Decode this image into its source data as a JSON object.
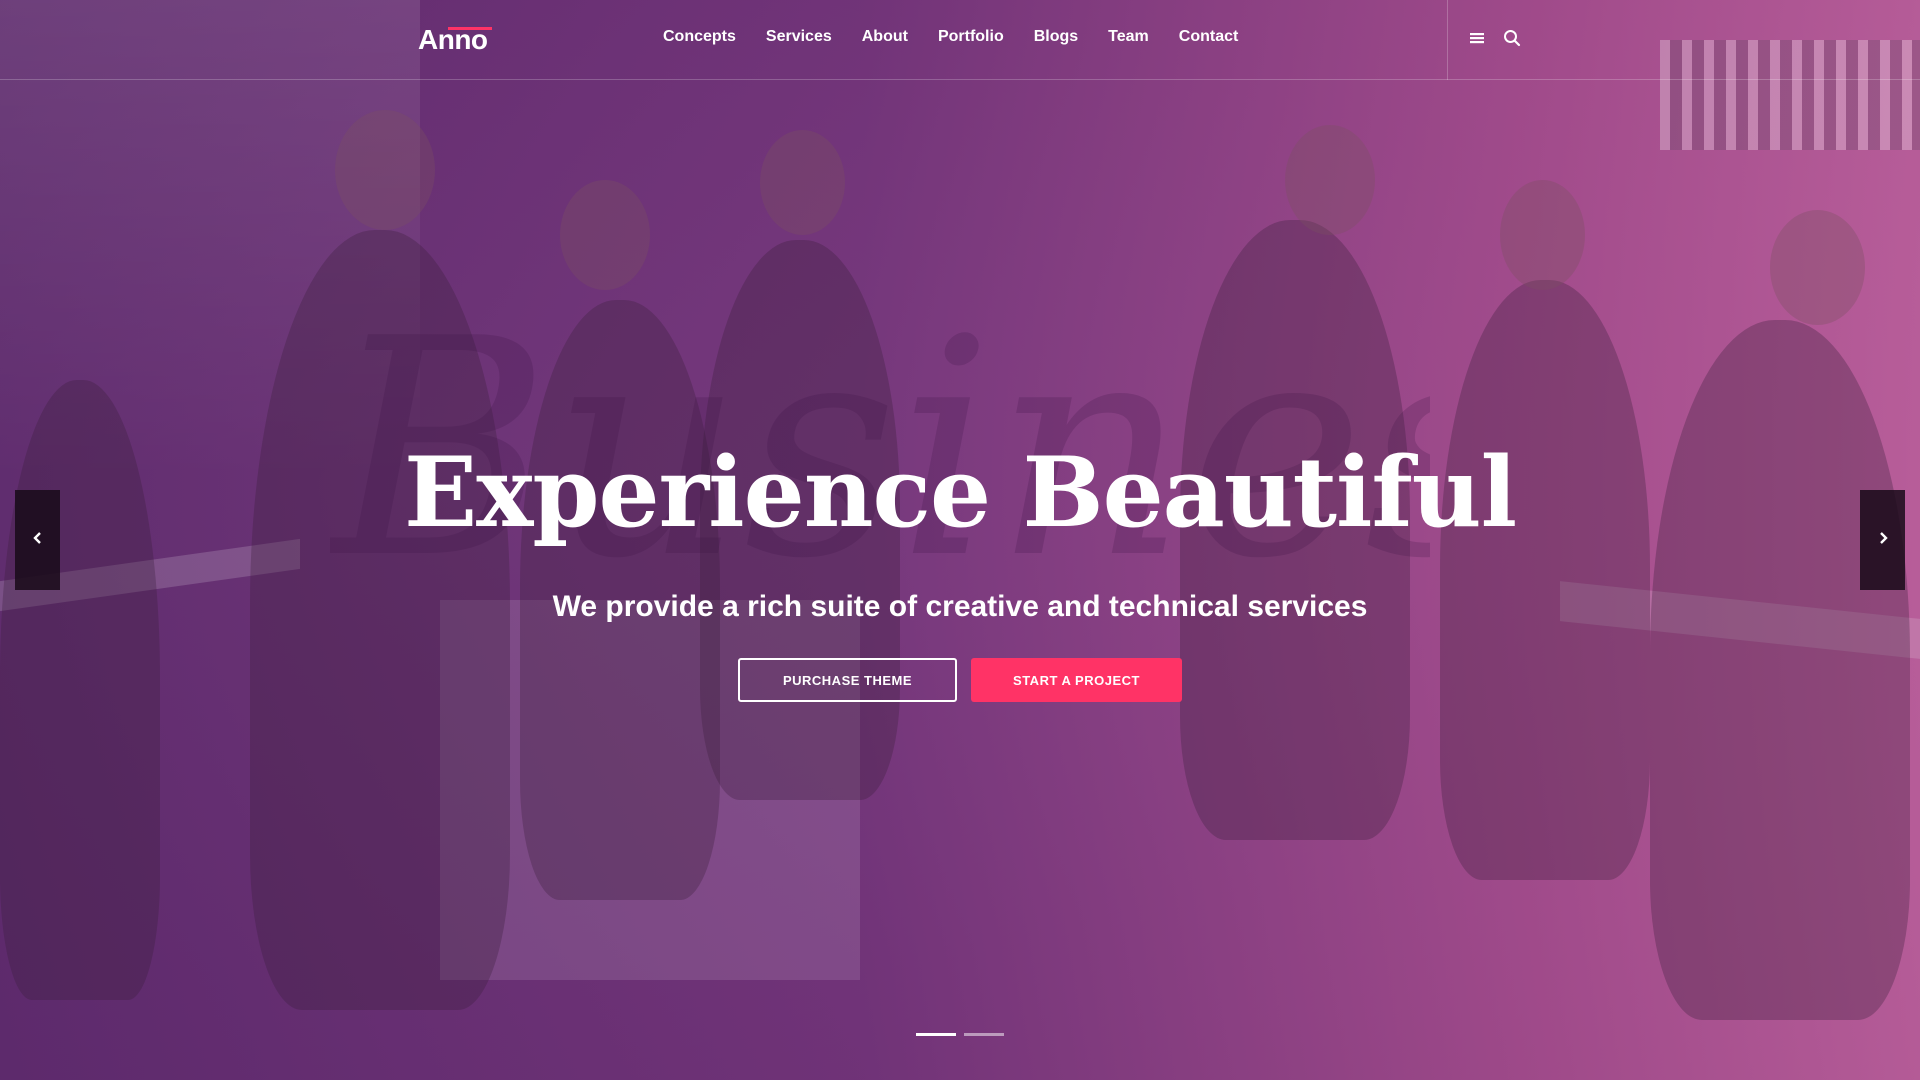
{
  "brand": {
    "logo_text": "Anno",
    "accent_color": "#ff3366"
  },
  "nav": {
    "items": [
      {
        "label": "Concepts"
      },
      {
        "label": "Services"
      },
      {
        "label": "About"
      },
      {
        "label": "Portfolio"
      },
      {
        "label": "Blogs"
      },
      {
        "label": "Team"
      },
      {
        "label": "Contact"
      }
    ],
    "icons": [
      "menu-icon",
      "search-icon"
    ]
  },
  "hero": {
    "watermark": "Business",
    "title": "Experience Beautiful",
    "subtitle": "We provide a rich suite of creative and technical services",
    "buttons": {
      "secondary_label": "PURCHASE THEME",
      "primary_label": "START A PROJECT"
    },
    "overlay_colors": [
      "#5f2a70",
      "#cc66aa"
    ]
  },
  "slider": {
    "prev_icon": "chevron-left-icon",
    "next_icon": "chevron-right-icon",
    "slide_count": 2,
    "active_slide": 1
  }
}
